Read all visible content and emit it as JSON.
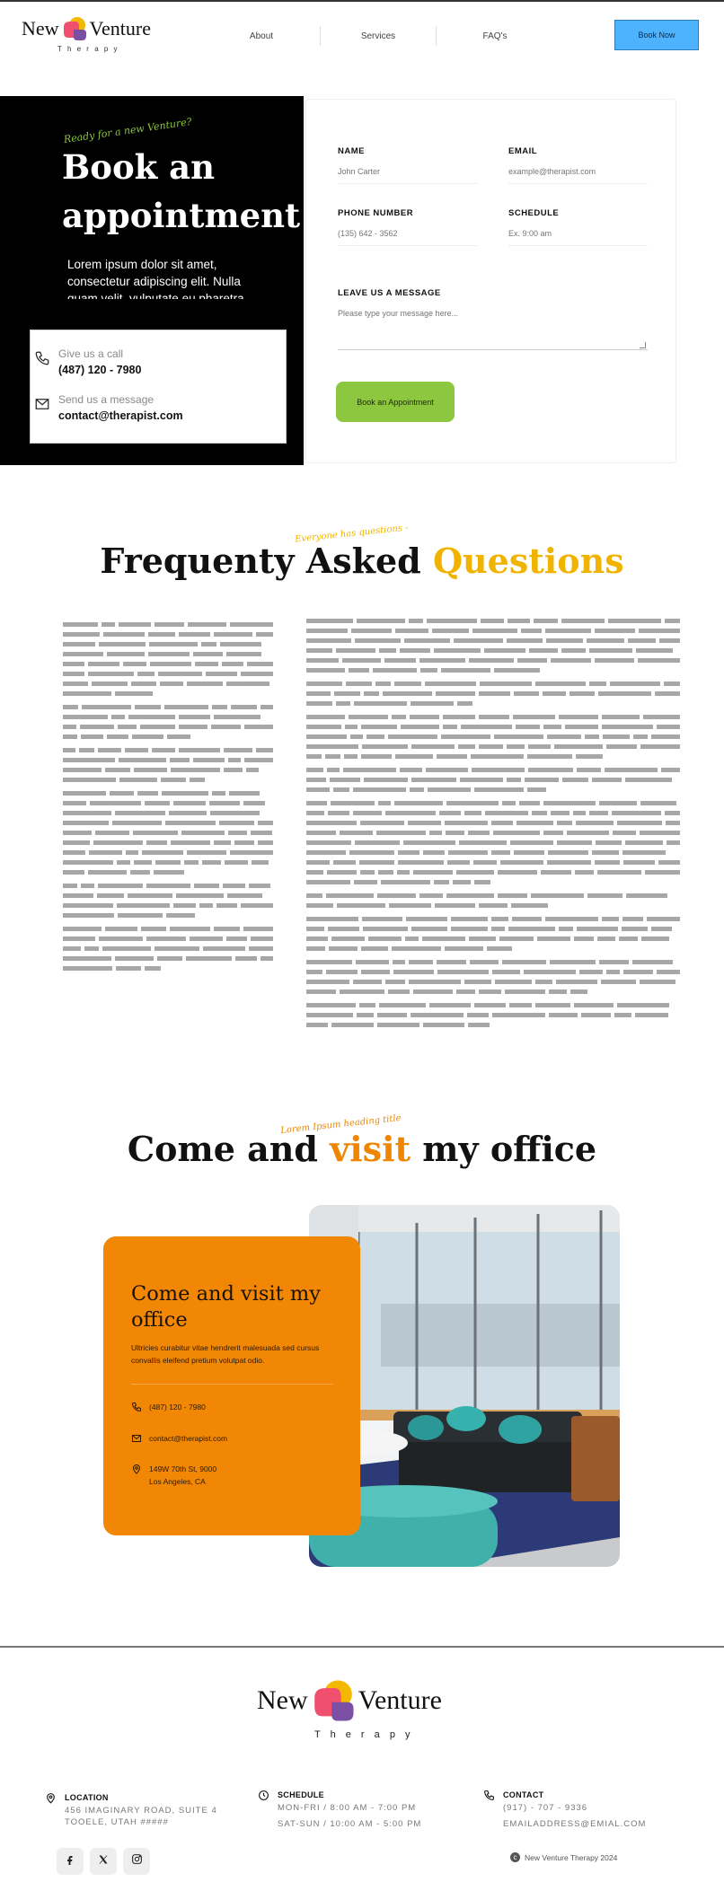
{
  "header": {
    "logo": {
      "word_left": "New",
      "word_right": "Venture",
      "sub": "T h e r a p y"
    },
    "nav": [
      {
        "label": "About"
      },
      {
        "label": "Services"
      },
      {
        "label": "FAQ's"
      }
    ],
    "cta_label": "Book Now"
  },
  "booking": {
    "eyebrow": "Ready for a new Venture?",
    "title": "Book an appointment",
    "description": "Lorem ipsum dolor sit amet, consectetur adipiscing elit. Nulla quam velit, vulputate eu pharetra",
    "call_label": "Give us a call",
    "call_value": "(487) 120 - 7980",
    "message_label": "Send us a message",
    "message_value": "contact@therapist.com",
    "form": {
      "name_label": "NAME",
      "name_placeholder": "John Carter",
      "email_label": "EMAIL",
      "email_placeholder": "example@therapist.com",
      "phone_label": "PHONE NUMBER",
      "phone_placeholder": "(135) 642 - 3562",
      "schedule_label": "SCHEDULE",
      "schedule_placeholder": "Ex. 9:00 am",
      "message_label": "LEAVE US A MESSAGE",
      "message_placeholder": "Please type your message here...",
      "submit_label": "Book an Appointment"
    }
  },
  "faq": {
    "eyebrow": "Everyone has questions -",
    "title_main": "Frequenty Asked",
    "title_accent": "Questions"
  },
  "visit": {
    "eyebrow": "Lorem Ipsum heading title",
    "title_before": "Come and",
    "title_accent": "visit",
    "title_after": "my office",
    "card_title": "Come and visit my office",
    "card_desc": "Ultricies curabitur vitae hendrerit malesuada sed cursus convallis eleifend pretium volutpat odio.",
    "phone": "(487) 120 - 7980",
    "email": "contact@therapist.com",
    "address_line1": "149W 70th St, 9000",
    "address_line2": "Los Angeles, CA"
  },
  "footer": {
    "logo": {
      "word_left": "New",
      "word_right": "Venture",
      "sub": "T h e r a p y"
    },
    "location_head": "LOCATION",
    "location_line1": "456 IMAGINARY ROAD, SUITE 4",
    "location_line2": "TOOELE, UTAH #####",
    "schedule_head": "SCHEDULE",
    "schedule_line1": "MON-FRI / 8:00 AM - 7:00 PM",
    "schedule_line2": "SAT-SUN / 10:00 AM - 5:00 PM",
    "contact_head": "CONTACT",
    "contact_line1": "(917) - 707 - 9336",
    "contact_line2": "EMAILADDRESS@EMIAL.COM",
    "copyright": "New Venture Therapy 2024"
  },
  "colors": {
    "accent_green": "#8dc63f",
    "accent_yellow": "#f0b400",
    "accent_orange": "#f28705",
    "button_blue": "#4db3ff",
    "logo_yellow": "#f5b800",
    "logo_pink": "#f0506e",
    "logo_purple": "#7b4fa3"
  }
}
